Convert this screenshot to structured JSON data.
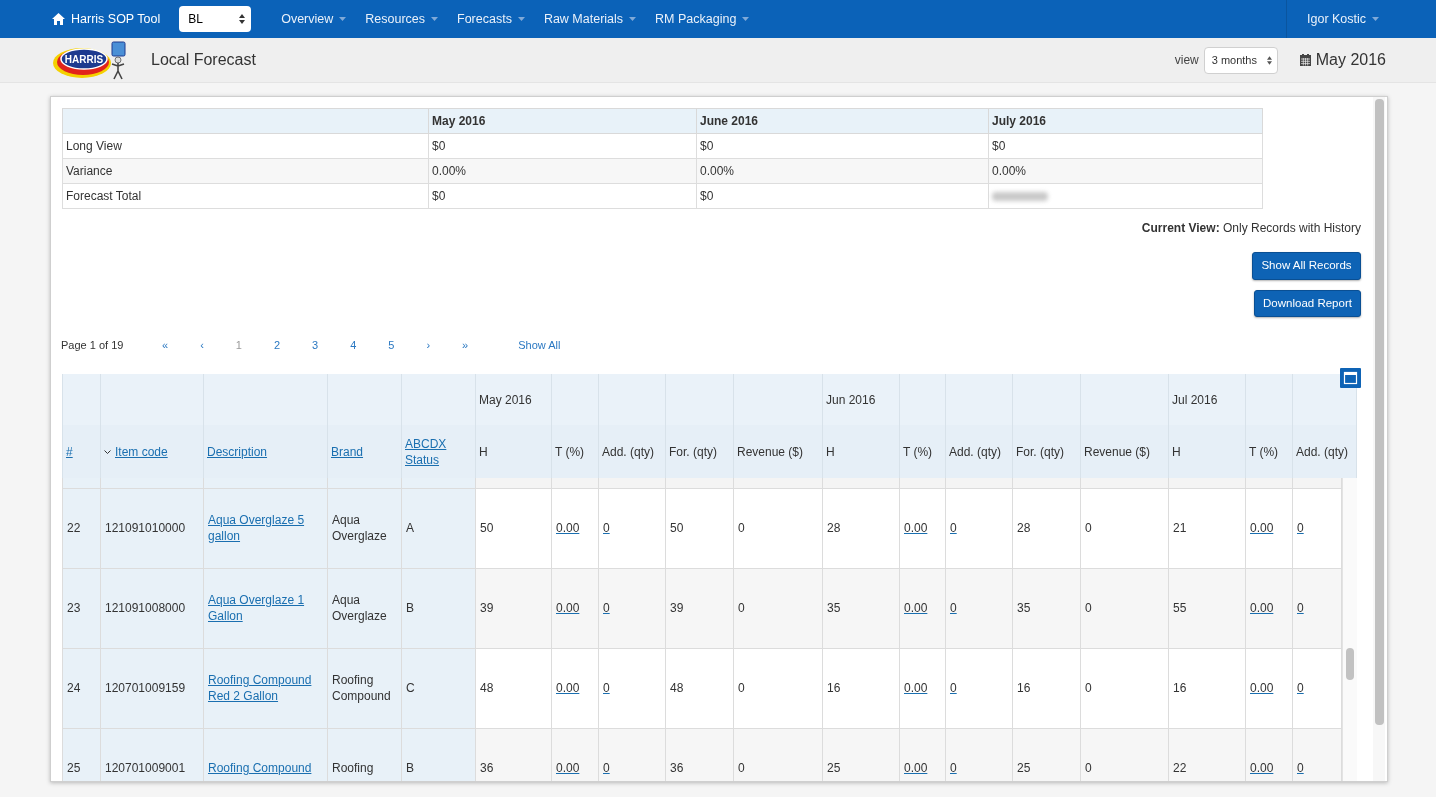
{
  "navbar": {
    "brand": "Harris SOP Tool",
    "site_select": {
      "value": "BL"
    },
    "menus": [
      {
        "label": "Overview"
      },
      {
        "label": "Resources"
      },
      {
        "label": "Forecasts"
      },
      {
        "label": "Raw Materials"
      },
      {
        "label": "RM Packaging"
      }
    ],
    "user_menu": {
      "label": "Igor Kostic"
    }
  },
  "page_header": {
    "logo_text": "HARRIS",
    "title": "Local Forecast",
    "view_label": "view",
    "view_select": {
      "value": "3 months"
    },
    "date": "May 2016"
  },
  "summary_table": {
    "columns": [
      "May 2016",
      "June 2016",
      "July 2016"
    ],
    "rows": [
      {
        "label": "Long View",
        "cells": [
          {
            "kind": "text",
            "text": "$0"
          },
          {
            "kind": "text",
            "text": "$0"
          },
          {
            "kind": "text",
            "text": "$0"
          }
        ]
      },
      {
        "label": "Variance",
        "cells": [
          {
            "kind": "text",
            "text": "0.00%"
          },
          {
            "kind": "text",
            "text": "0.00%"
          },
          {
            "kind": "text",
            "text": "0.00%"
          }
        ]
      },
      {
        "label": "Forecast Total",
        "cells": [
          {
            "kind": "text",
            "text": "$0"
          },
          {
            "kind": "text",
            "text": "$0"
          },
          {
            "kind": "blurred"
          }
        ]
      }
    ]
  },
  "current_view": "**Current View:** Only Records with History",
  "buttons": [
    {
      "label": "Show All Records"
    },
    {
      "label": "Download Report"
    }
  ],
  "pagination": {
    "summary": "Page 1 of 19",
    "links": [
      {
        "label": "«",
        "selected": false
      },
      {
        "label": "‹",
        "selected": false
      },
      {
        "label": "1",
        "selected": true
      },
      {
        "label": "2",
        "selected": false
      },
      {
        "label": "3",
        "selected": false
      },
      {
        "label": "4",
        "selected": false
      },
      {
        "label": "5",
        "selected": false
      },
      {
        "label": "›",
        "selected": false
      },
      {
        "label": "»",
        "selected": false
      }
    ],
    "show_all": "Show All"
  },
  "forecast_table": {
    "key_columns": [
      {
        "label": "#",
        "sorted": false
      },
      {
        "label": "Item code",
        "sorted": true
      },
      {
        "label": "Description",
        "sorted": false
      },
      {
        "label": "Brand",
        "sorted": false
      },
      {
        "label": "ABCDX Status",
        "sorted": false
      }
    ],
    "months": [
      {
        "label": "May 2016",
        "columns": [
          {
            "label": "H",
            "kind": "text"
          },
          {
            "label": "T (%)",
            "kind": "link"
          },
          {
            "label": "Add. (qty)",
            "kind": "link"
          },
          {
            "label": "For. (qty)",
            "kind": "text"
          },
          {
            "label": "Revenue ($)",
            "kind": "text"
          }
        ]
      },
      {
        "label": "Jun 2016",
        "columns": [
          {
            "label": "H",
            "kind": "text"
          },
          {
            "label": "T (%)",
            "kind": "link"
          },
          {
            "label": "Add. (qty)",
            "kind": "link"
          },
          {
            "label": "For. (qty)",
            "kind": "text"
          },
          {
            "label": "Revenue ($)",
            "kind": "text"
          }
        ]
      },
      {
        "label": "Jul 2016",
        "columns": [
          {
            "label": "H",
            "kind": "text"
          },
          {
            "label": "T (%)",
            "kind": "link"
          },
          {
            "label": "Add. (qty)",
            "kind": "link"
          }
        ]
      }
    ],
    "rows": [
      {
        "number": "22",
        "item_code": "121091010000",
        "description": "Aqua Overglaze 5 gallon",
        "brand": "Aqua Overglaze",
        "status": "A",
        "values": [
          [
            "50",
            "0.00",
            "0",
            "50",
            "0"
          ],
          [
            "28",
            "0.00",
            "0",
            "28",
            "0"
          ],
          [
            "21",
            "0.00",
            "0"
          ]
        ]
      },
      {
        "number": "23",
        "item_code": "121091008000",
        "description": "Aqua Overglaze 1 Gallon",
        "brand": "Aqua Overglaze",
        "status": "B",
        "values": [
          [
            "39",
            "0.00",
            "0",
            "39",
            "0"
          ],
          [
            "35",
            "0.00",
            "0",
            "35",
            "0"
          ],
          [
            "55",
            "0.00",
            "0"
          ]
        ]
      },
      {
        "number": "24",
        "item_code": "120701009159",
        "description": "Roofing Compound Red 2 Gallon",
        "brand": "Roofing Compound",
        "status": "C",
        "values": [
          [
            "48",
            "0.00",
            "0",
            "48",
            "0"
          ],
          [
            "16",
            "0.00",
            "0",
            "16",
            "0"
          ],
          [
            "16",
            "0.00",
            "0"
          ]
        ]
      },
      {
        "number": "25",
        "item_code": "120701009001",
        "description": "Roofing Compound",
        "brand": "Roofing",
        "status": "B",
        "values": [
          [
            "36",
            "0.00",
            "0",
            "36",
            "0"
          ],
          [
            "25",
            "0.00",
            "0",
            "25",
            "0"
          ],
          [
            "22",
            "0.00",
            "0"
          ]
        ]
      }
    ]
  }
}
